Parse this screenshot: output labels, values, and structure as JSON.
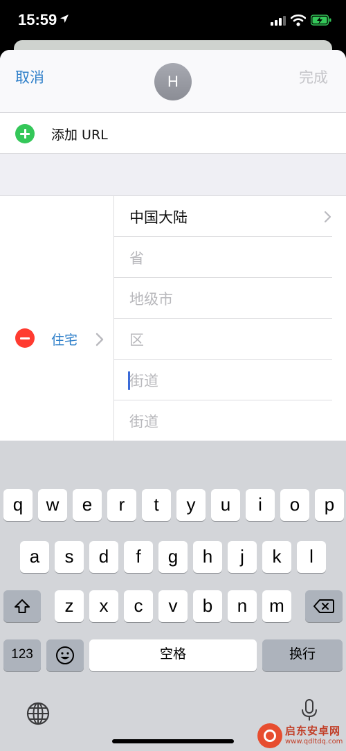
{
  "status_bar": {
    "time": "15:59"
  },
  "nav": {
    "cancel": "取消",
    "avatar_initial": "H",
    "done": "完成"
  },
  "url_row": {
    "label": "添加 URL"
  },
  "address": {
    "type_label": "住宅",
    "fields": [
      {
        "text": "中国大陆",
        "filled": true
      },
      {
        "text": "省",
        "filled": false
      },
      {
        "text": "地级市",
        "filled": false
      },
      {
        "text": "区",
        "filled": false
      },
      {
        "text": "街道",
        "filled": false,
        "focused": true
      },
      {
        "text": "街道",
        "filled": false
      }
    ]
  },
  "keyboard": {
    "row1": [
      "q",
      "w",
      "e",
      "r",
      "t",
      "y",
      "u",
      "i",
      "o",
      "p"
    ],
    "row2": [
      "a",
      "s",
      "d",
      "f",
      "g",
      "h",
      "j",
      "k",
      "l"
    ],
    "row3": [
      "z",
      "x",
      "c",
      "v",
      "b",
      "n",
      "m"
    ],
    "numbers_key": "123",
    "space_key": "空格",
    "return_key": "换行"
  },
  "watermark": {
    "name": "启东安卓网",
    "url": "www.qdltdq.com"
  },
  "colors": {
    "link_blue": "#2e7fc9",
    "add_green": "#34c759",
    "remove_red": "#ff3b30",
    "keyboard_bg": "#d3d5d9"
  }
}
